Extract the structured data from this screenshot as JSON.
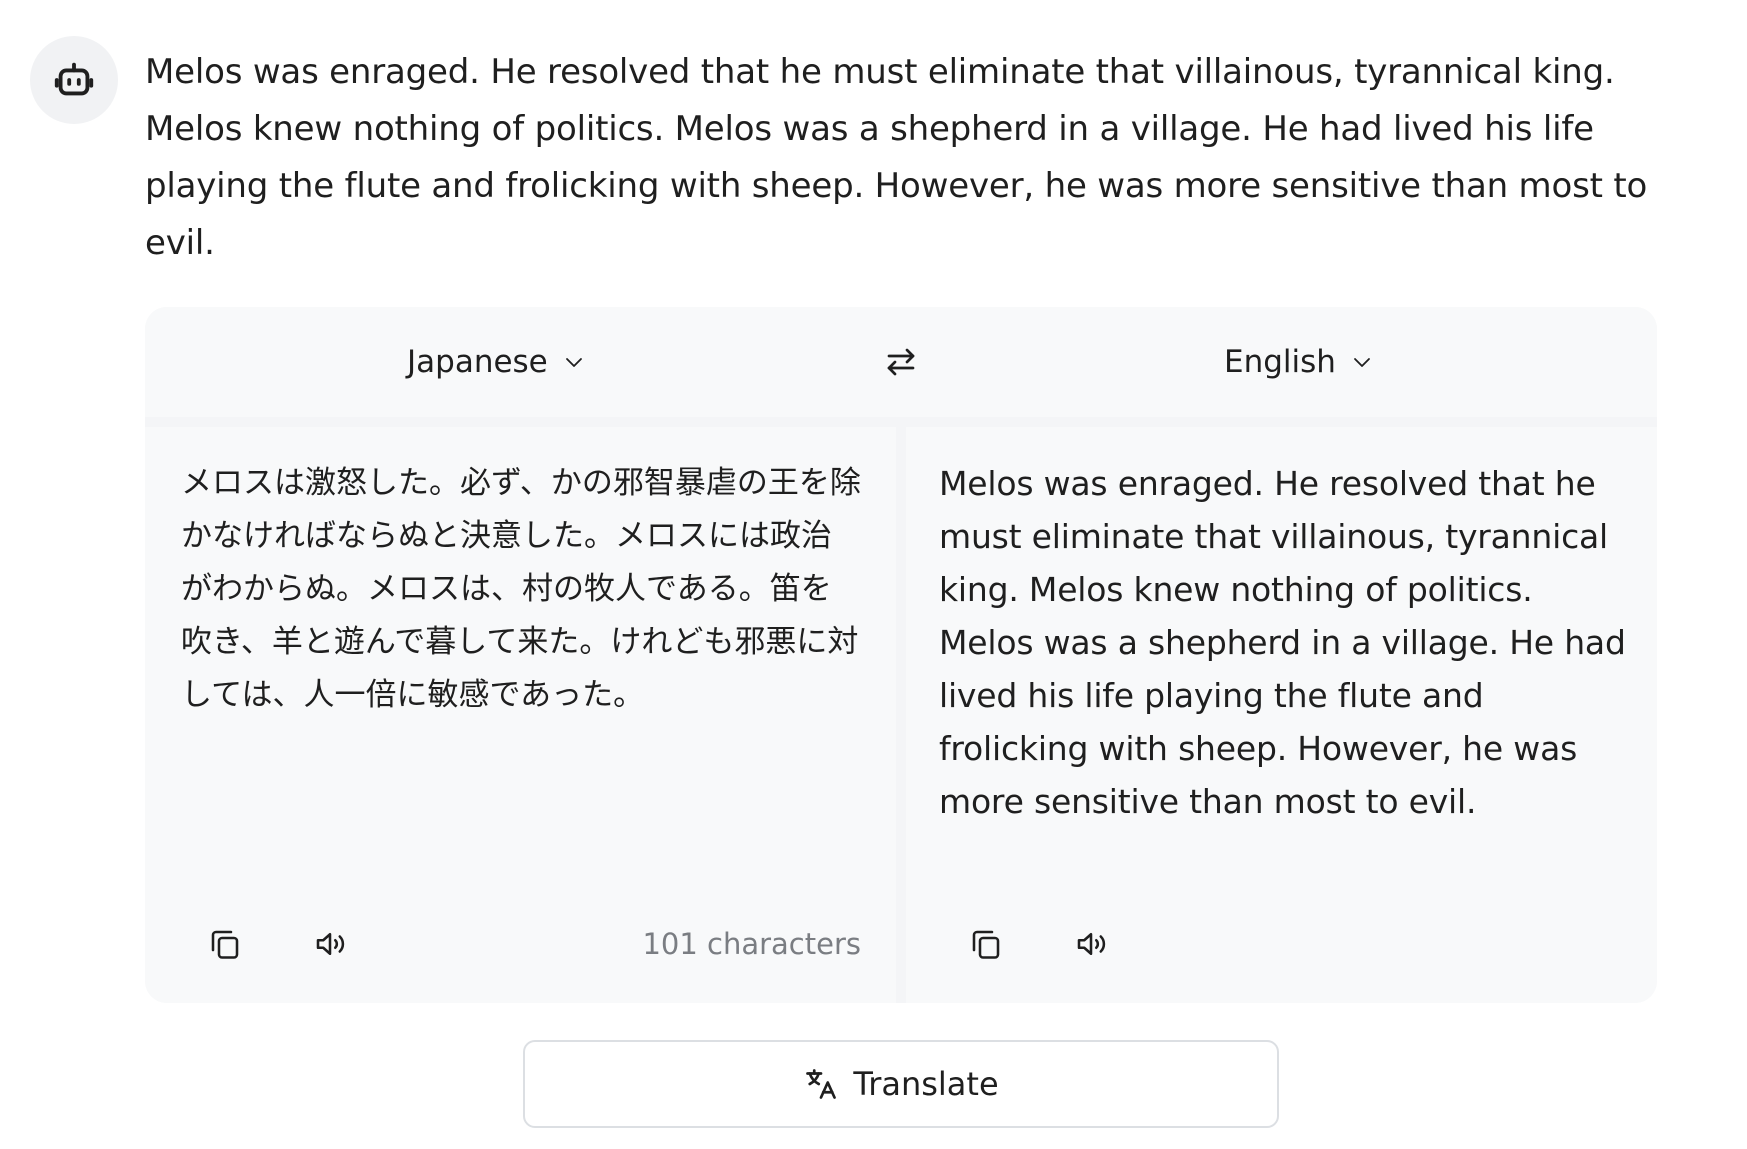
{
  "message": {
    "text": "Melos was enraged. He resolved that he must eliminate that villainous, tyrannical king. Melos knew nothing of politics. Melos was a shepherd in a village. He had lived his life playing the flute and frolicking with sheep. However, he was more sensitive than most to evil."
  },
  "translator": {
    "source_language": "Japanese",
    "target_language": "English",
    "source_text": "メロスは激怒した。必ず、かの邪智暴虐の王を除かなければならぬと決意した。メロスには政治がわからぬ。メロスは、村の牧人である。笛を吹き、羊と遊んで暮して来た。けれども邪悪に対しては、人一倍に敏感であった。",
    "translated_text": "Melos was enraged. He resolved that he must eliminate that villainous, tyrannical king. Melos knew nothing of politics. Melos was a shepherd in a village. He had lived his life playing the flute and frolicking with sheep. However, he was more sensitive than most to evil.",
    "char_count": "101 characters",
    "translate_label": "Translate"
  },
  "icons": {
    "avatar": "robot-icon",
    "dropdown": "chevron-down-icon",
    "swap": "swap-arrows-icon",
    "copy": "copy-icon",
    "speak": "speaker-icon",
    "translate": "translate-icon"
  },
  "colors": {
    "panel_background": "#f8f9fa",
    "text": "#1f1f1f",
    "muted_text": "#7a7d82",
    "button_border": "#dcdfe3"
  }
}
